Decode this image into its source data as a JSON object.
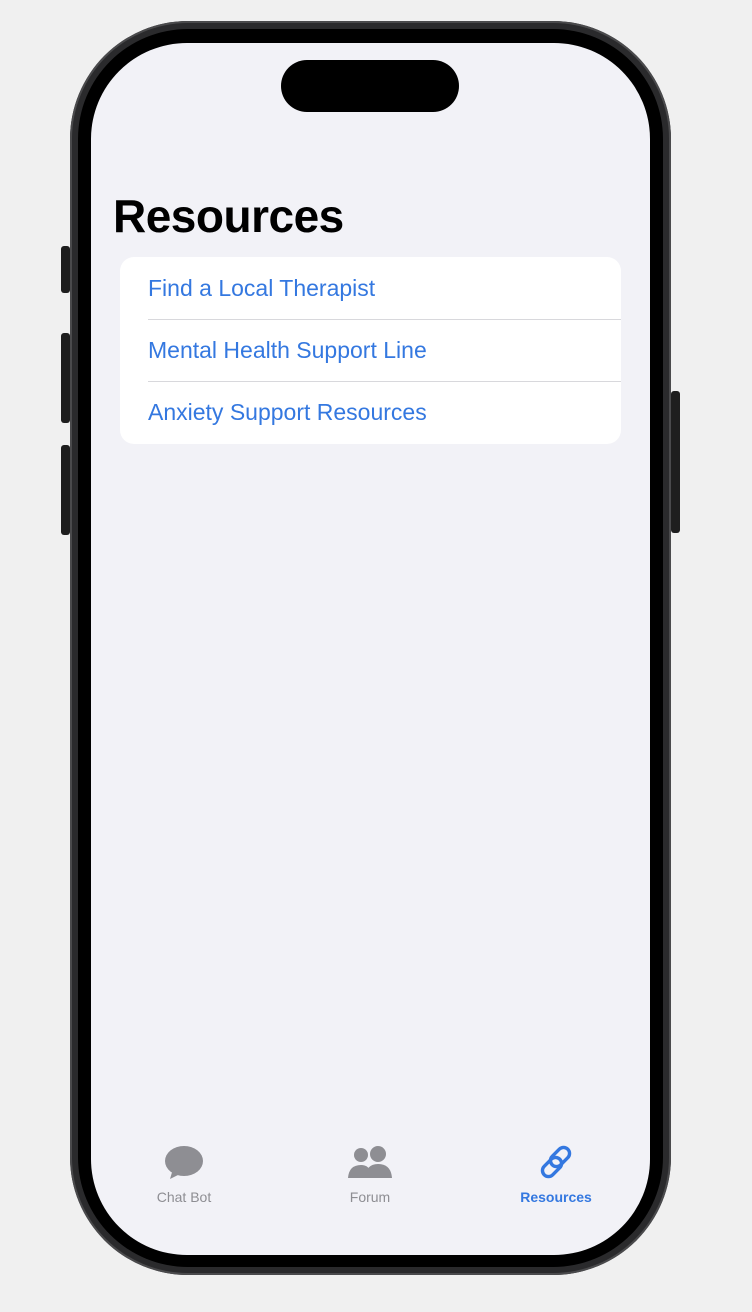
{
  "page": {
    "title": "Resources"
  },
  "resources": {
    "items": [
      {
        "label": "Find a Local Therapist"
      },
      {
        "label": "Mental Health Support Line"
      },
      {
        "label": "Anxiety Support Resources"
      }
    ]
  },
  "tabbar": {
    "tabs": [
      {
        "label": "Chat Bot",
        "icon": "chat-bubble-icon",
        "selected": false
      },
      {
        "label": "Forum",
        "icon": "people-icon",
        "selected": false
      },
      {
        "label": "Resources",
        "icon": "link-icon",
        "selected": true
      }
    ]
  },
  "colors": {
    "accent": "#3478e0",
    "inactive": "#8e8e93",
    "background": "#f2f2f7",
    "card": "#ffffff"
  }
}
